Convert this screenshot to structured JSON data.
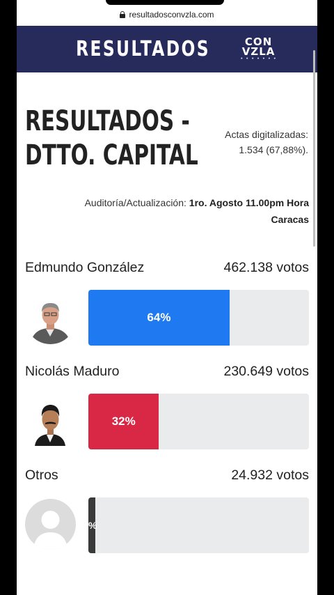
{
  "browser": {
    "url": "resultadosconvzla.com"
  },
  "header": {
    "title": "RESULTADOS",
    "logo_top": "CON",
    "logo_bottom": "VZLA",
    "logo_dots": "• • • • • • •"
  },
  "page": {
    "title_line1": "RESULTADOS -",
    "title_line2": "DTTO. CAPITAL",
    "actas_label": "Actas digitalizadas:",
    "actas_value": "1.534 (67,88%).",
    "audit_label": "Auditoría/Actualización:",
    "audit_value": "1ro. Agosto 11.00pm Hora Caracas"
  },
  "candidates": [
    {
      "name": "Edmundo González",
      "votes": "462.138 votos",
      "percent_label": "64%",
      "percent": 64,
      "color": "#1f7af2"
    },
    {
      "name": "Nicolás Maduro",
      "votes": "230.649 votos",
      "percent_label": "32%",
      "percent": 32,
      "color": "#d82845"
    },
    {
      "name": "Otros",
      "votes": "24.932 votos",
      "percent_label": "%",
      "percent": 3,
      "color": "#3a3a3a"
    }
  ]
}
